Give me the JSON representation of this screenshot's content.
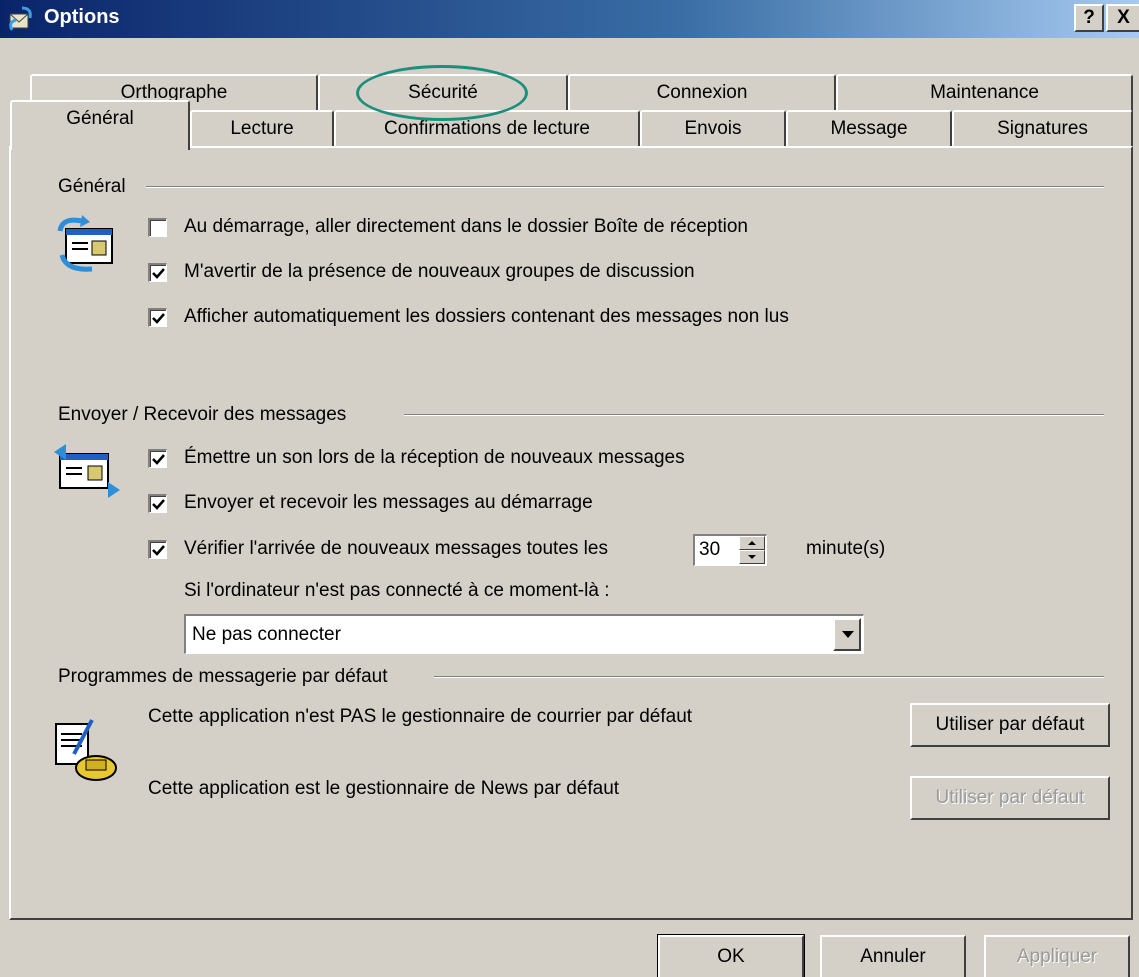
{
  "window": {
    "title": "Options",
    "help_label": "?",
    "close_label": "X"
  },
  "tabs": {
    "row1": [
      {
        "label": "Orthographe"
      },
      {
        "label": "Sécurité"
      },
      {
        "label": "Connexion"
      },
      {
        "label": "Maintenance"
      }
    ],
    "row2": [
      {
        "label": "Général",
        "active": true
      },
      {
        "label": "Lecture"
      },
      {
        "label": "Confirmations de lecture"
      },
      {
        "label": "Envois"
      },
      {
        "label": "Message"
      },
      {
        "label": "Signatures"
      }
    ]
  },
  "general": {
    "heading": "Général",
    "options": [
      {
        "label": "Au démarrage, aller directement dans le dossier Boîte de réception",
        "checked": false
      },
      {
        "label": "M'avertir de la présence de nouveaux groupes de discussion",
        "checked": true
      },
      {
        "label": "Afficher automatiquement les dossiers contenant des messages non lus",
        "checked": true
      }
    ]
  },
  "send_receive": {
    "heading": "Envoyer / Recevoir des messages",
    "options": [
      {
        "label": "Émettre un son lors de la réception de nouveaux messages",
        "checked": true
      },
      {
        "label": "Envoyer et recevoir les messages au démarrage",
        "checked": true
      },
      {
        "label": "Vérifier l'arrivée de nouveaux messages toutes les",
        "checked": true
      }
    ],
    "interval_value": "30",
    "interval_unit": "minute(s)",
    "not_connected_label": "Si l'ordinateur n'est pas connecté à ce moment-là :",
    "not_connected_value": "Ne pas connecter"
  },
  "default_programs": {
    "heading": "Programmes de messagerie par défaut",
    "mail_text": "Cette application n'est PAS le gestionnaire de courrier par défaut",
    "mail_button": "Utiliser par défaut",
    "news_text": "Cette application est le gestionnaire de News par défaut",
    "news_button": "Utiliser par défaut"
  },
  "footer": {
    "ok": "OK",
    "cancel": "Annuler",
    "apply": "Appliquer"
  },
  "colors": {
    "face": "#d4d0c8",
    "title_start": "#0a246a",
    "title_end": "#a6caf0",
    "highlight": "#1b8f7e"
  }
}
